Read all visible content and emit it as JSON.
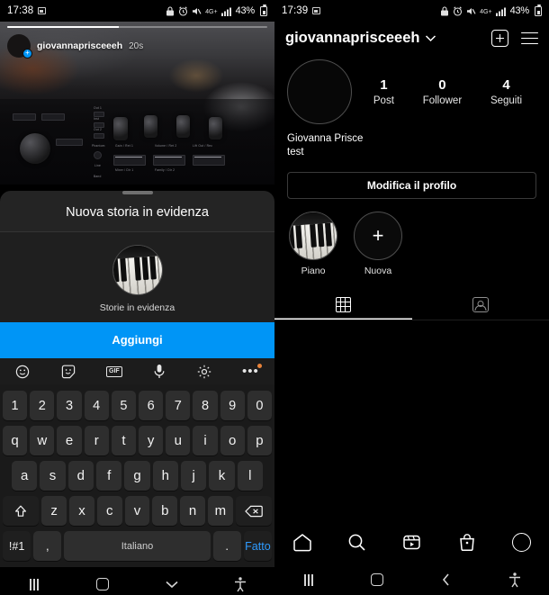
{
  "left": {
    "status": {
      "time": "17:38",
      "battery": "43%",
      "network": "4G+",
      "icons": [
        "screenshot-icon",
        "privacy-lock-icon",
        "alarm-icon",
        "mute-icon",
        "network-4gplus-icon",
        "signal-bars-icon",
        "battery-icon"
      ]
    },
    "story": {
      "username": "giovannaprisceeeh",
      "time_ago": "20s",
      "progress_percent": 43
    },
    "sheet": {
      "title": "Nuova storia in evidenza",
      "cover_label": "Storie in evidenza",
      "add_button": "Aggiungi"
    },
    "keyboard": {
      "toolbar": [
        "emoji-icon",
        "sticker-icon",
        "gif-icon",
        "microphone-icon",
        "settings-gear-icon",
        "more-options-icon"
      ],
      "row_numbers": [
        "1",
        "2",
        "3",
        "4",
        "5",
        "6",
        "7",
        "8",
        "9",
        "0"
      ],
      "row_top": [
        "q",
        "w",
        "e",
        "r",
        "t",
        "y",
        "u",
        "i",
        "o",
        "p"
      ],
      "row_home": [
        "a",
        "s",
        "d",
        "f",
        "g",
        "h",
        "j",
        "k",
        "l"
      ],
      "row_bottom": [
        "z",
        "x",
        "c",
        "v",
        "b",
        "n",
        "m"
      ],
      "shift_label": "shift-key",
      "backspace_label": "backspace-key",
      "symbols_key": "!#1",
      "comma_key": ",",
      "space_key": "Italiano",
      "period_key": ".",
      "done_key": "Fatto"
    },
    "navbar": [
      "recents-button",
      "home-button",
      "hide-keyboard-button",
      "accessibility-button"
    ]
  },
  "right": {
    "status": {
      "time": "17:39",
      "battery": "43%",
      "network": "4G+"
    },
    "header": {
      "username": "giovannaprisceeeh",
      "chevron": "chevron-down-icon",
      "add_label": "add-new-icon",
      "menu_label": "menu-icon"
    },
    "stats": [
      {
        "num": "1",
        "label": "Post"
      },
      {
        "num": "0",
        "label": "Follower"
      },
      {
        "num": "4",
        "label": "Seguiti"
      }
    ],
    "bio": {
      "name": "Giovanna Prisce",
      "line2": "test"
    },
    "edit_button": "Modifica il profilo",
    "highlights": [
      {
        "label": "Piano",
        "type": "cover"
      },
      {
        "label": "Nuova",
        "type": "new"
      }
    ],
    "tabs": [
      {
        "name": "grid",
        "icon": "grid-icon",
        "active": true
      },
      {
        "name": "tagged",
        "icon": "tagged-icon",
        "active": false
      }
    ],
    "bottom_nav": [
      "home-icon",
      "search-icon",
      "reels-icon",
      "shop-icon",
      "profile-avatar-icon"
    ],
    "navbar": [
      "recents-button",
      "home-button",
      "back-button",
      "accessibility-button"
    ]
  },
  "colors": {
    "accent_blue": "#0095f6",
    "sheet_bg": "#242424",
    "key_bg": "#2e2e2e"
  }
}
